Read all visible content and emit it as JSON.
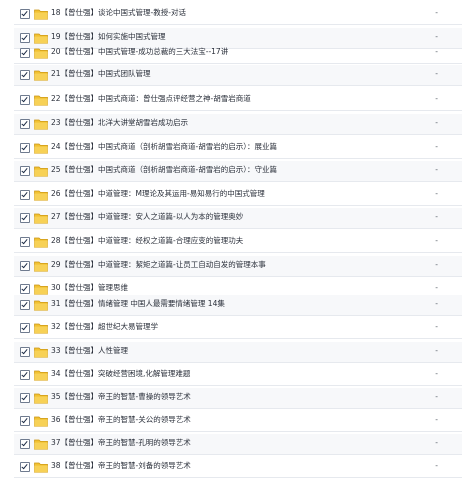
{
  "list": {
    "folder_color": "#f2c232",
    "check_color": "#1b2a44",
    "size_placeholder": "-",
    "items": [
      {
        "name": "18【曾仕强】谈论中国式管理-教授-对话"
      },
      {
        "name": "19【曾仕强】如何实施中国式管理"
      },
      {
        "name": "20【曾仕强】中国式管理-成功总裁的三大法宝--17讲"
      },
      {
        "name": "21【曾仕强】中国式团队管理"
      },
      {
        "name": "22【曾仕强】中国式商道：曾仕强点评经营之神-胡雪岩商道"
      },
      {
        "name": "23【曾仕强】北洋大讲堂胡雪岩成功启示"
      },
      {
        "name": "24【曾仕强】中国式商道（剖析胡雪岩商道-胡雪岩的启示）：展业篇"
      },
      {
        "name": "25【曾仕强】中国式商道（剖析胡雪岩商道-胡雪岩的启示）：守业篇"
      },
      {
        "name": "26【曾仕强】中道管理：M理论及其运用-易知易行的中国式管理"
      },
      {
        "name": "27【曾仕强】中道管理：安人之道篇-以人为本的管理奥妙"
      },
      {
        "name": "28【曾仕强】中道管理：经权之道篇-合理应变的管理功夫"
      },
      {
        "name": "29【曾仕强】中道管理：絜矩之道篇-让员工自动自发的管理本事"
      },
      {
        "name": "30【曾仕强】管理思维"
      },
      {
        "name": "31【曾仕强】情绪管理 中国人最需要情绪管理 14集"
      },
      {
        "name": "32【曾仕强】超世纪大易管理学"
      },
      {
        "name": "33【曾仕强】人性管理"
      },
      {
        "name": "34【曾仕强】突破经营困境,化解管理难题"
      },
      {
        "name": "35【曾仕强】帝王的智慧-曹操的领导艺术"
      },
      {
        "name": "36【曾仕强】帝王的智慧-关公的领导艺术"
      },
      {
        "name": "37【曾仕强】帝王的智慧-孔明的领导艺术"
      },
      {
        "name": "38【曾仕强】帝王的智慧-刘备的领导艺术"
      }
    ]
  }
}
